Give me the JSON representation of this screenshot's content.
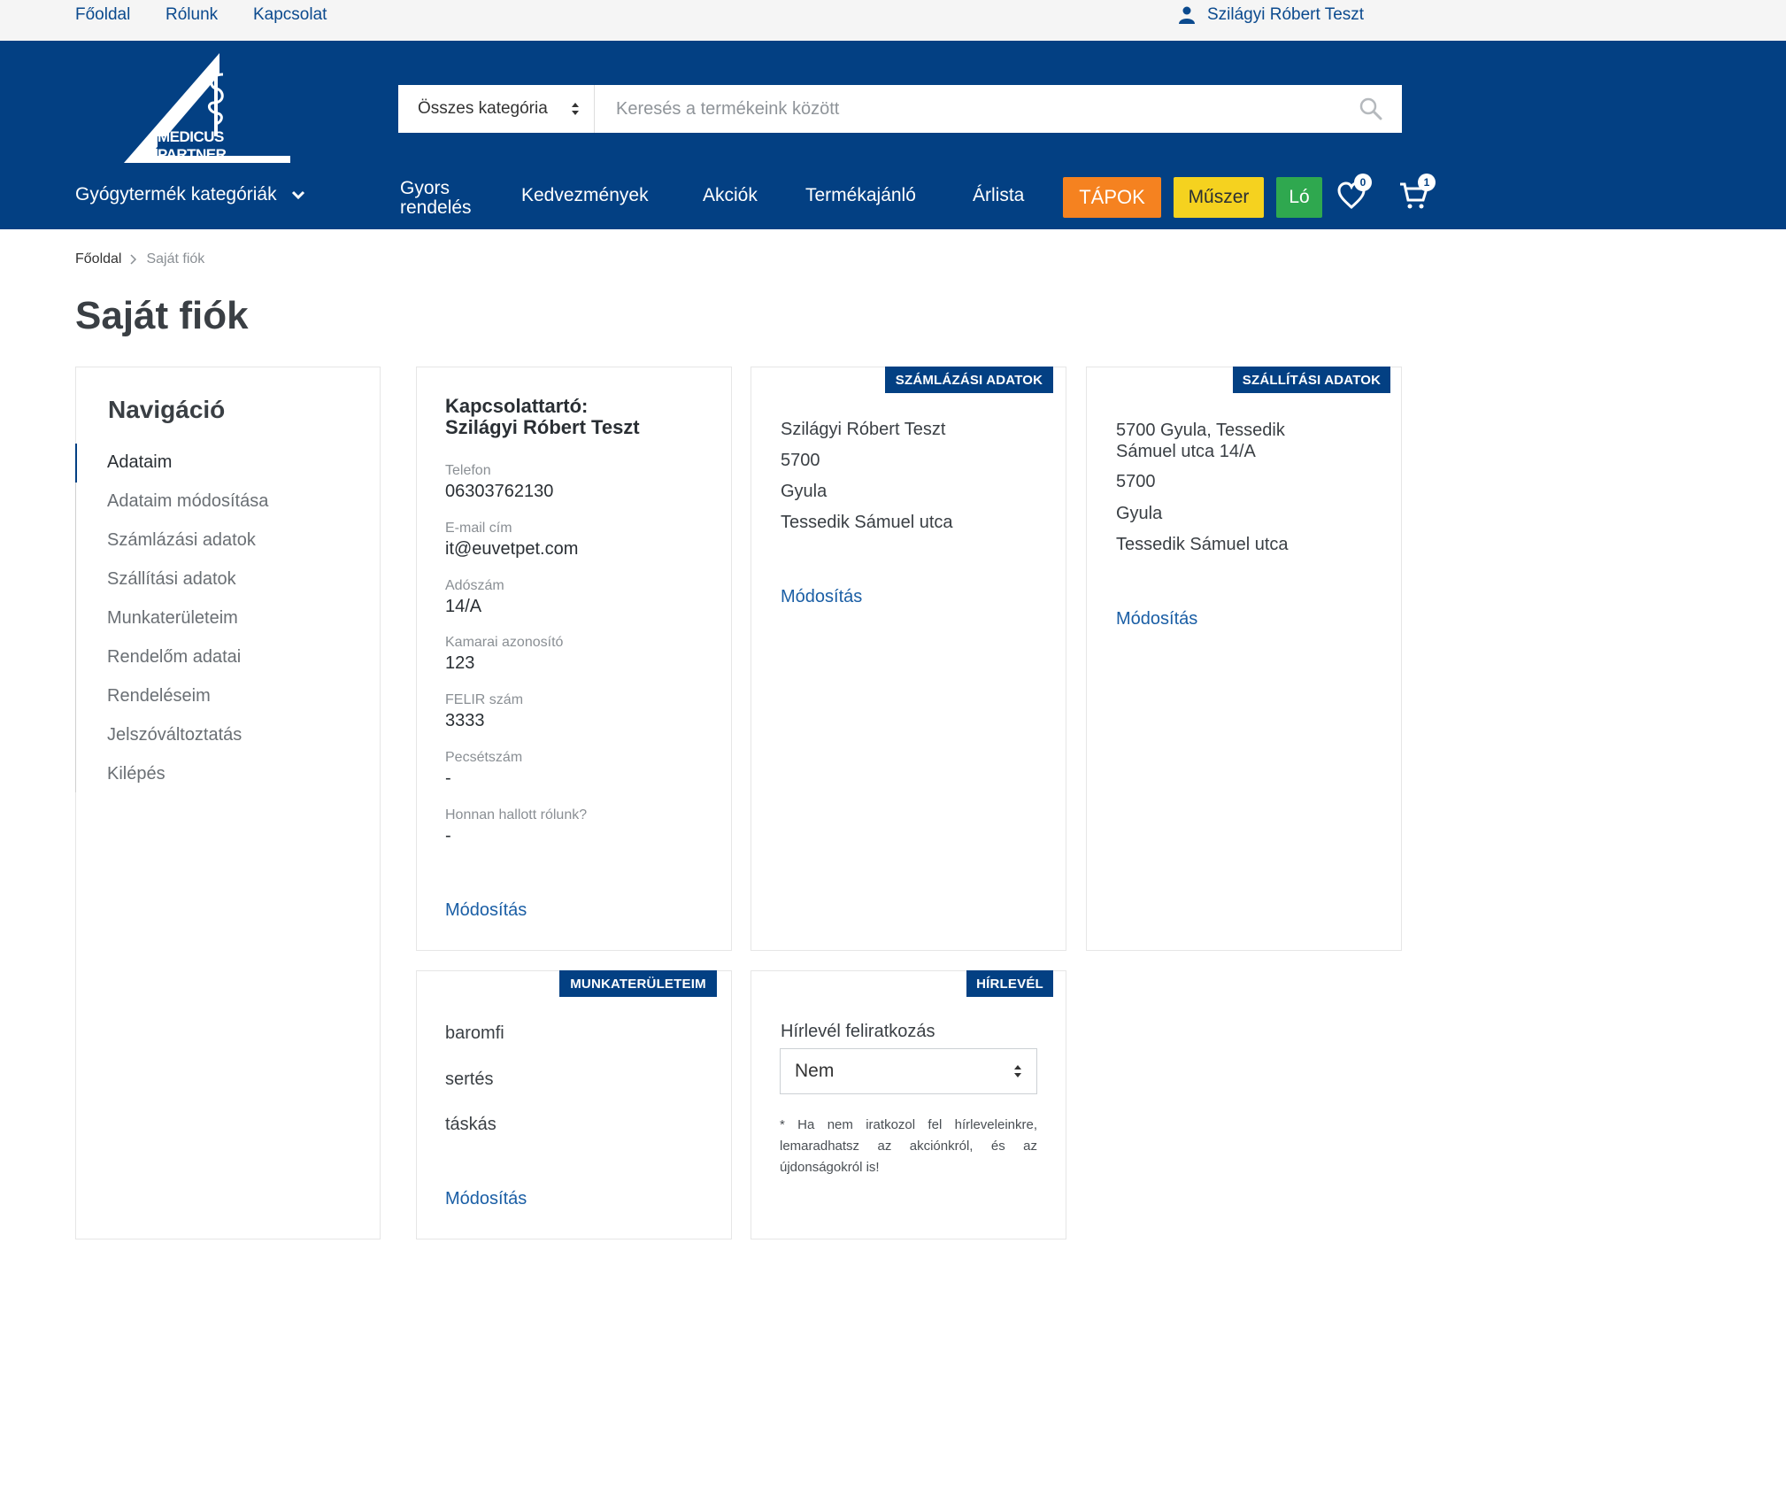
{
  "topbar": {
    "links": [
      "Főoldal",
      "Rólunk",
      "Kapcsolat"
    ],
    "user": "Szilágyi Róbert Teszt"
  },
  "header": {
    "logo_text": "MEDICUS PARTNER",
    "search": {
      "category": "Összes kategória",
      "placeholder": "Keresés a termékeink között"
    },
    "categories_label": "Gyógytermék kategóriák",
    "nav": {
      "quick_order": "Gyors rendelés",
      "discounts": "Kedvezmények",
      "sales": "Akciók",
      "recommender": "Termékajánló",
      "pricelist": "Árlista"
    },
    "tags": {
      "tapok": "TÁPOK",
      "muszer": "Műszer",
      "lo": "Ló"
    },
    "wishlist_count": "0",
    "cart_count": "1",
    "colors": {
      "primary": "#034083",
      "orange": "#f58220",
      "yellow": "#f5d21f",
      "green": "#2fa84f"
    }
  },
  "breadcrumb": {
    "home": "Főoldal",
    "current": "Saját fiók"
  },
  "page_title": "Saját fiók",
  "navigation": {
    "title": "Navigáció",
    "items": [
      "Adataim",
      "Adataim módosítása",
      "Számlázási adatok",
      "Szállítási adatok",
      "Munkaterületeim",
      "Rendelőm adatai",
      "Rendeléseim",
      "Jelszóváltoztatás",
      "Kilépés"
    ]
  },
  "contact": {
    "title_line1": "Kapcsolattartó:",
    "title_line2": "Szilágyi Róbert Teszt",
    "phone_label": "Telefon",
    "phone": "06303762130",
    "email_label": "E-mail cím",
    "email": "it@euvetpet.com",
    "tax_label": "Adószám",
    "tax": "14/A",
    "chamber_label": "Kamarai azonosító",
    "chamber": "123",
    "felir_label": "FELIR szám",
    "felir": "3333",
    "stamp_label": "Pecsétszám",
    "stamp": "-",
    "source_label": "Honnan hallott rólunk?",
    "source": "-",
    "edit": "Módosítás"
  },
  "billing": {
    "tag": "SZÁMLÁZÁSI ADATOK",
    "lines": [
      "Szilágyi Róbert Teszt",
      "5700",
      "Gyula",
      "Tessedik Sámuel utca"
    ],
    "edit": "Módosítás"
  },
  "shipping": {
    "tag": "SZÁLLÍTÁSI ADATOK",
    "address_line1": "5700 Gyula, Tessedik",
    "address_line2": "Sámuel utca 14/A",
    "lines": [
      "5700",
      "Gyula",
      "Tessedik Sámuel utca"
    ],
    "edit": "Módosítás"
  },
  "workareas": {
    "tag": "MUNKATERÜLETEIM",
    "items": [
      "baromfi",
      "sertés",
      "táskás"
    ],
    "edit": "Módosítás"
  },
  "newsletter": {
    "tag": "HÍRLEVÉL",
    "label": "Hírlevél feliratkozás",
    "selected": "Nem",
    "note": "* Ha nem iratkozol fel hírleveleinkre, lemaradhatsz az akciónkról, és az újdonságokról is!"
  }
}
